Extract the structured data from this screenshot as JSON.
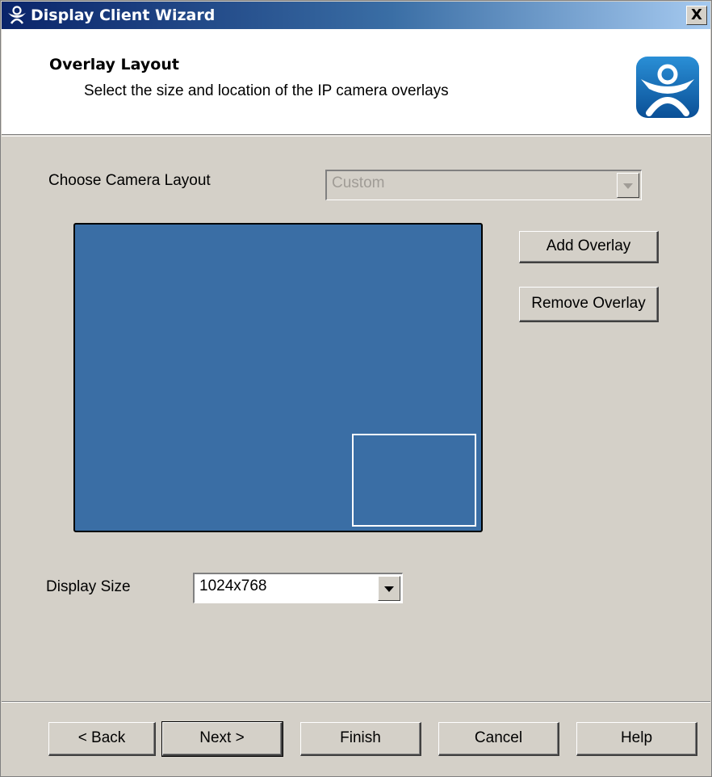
{
  "window": {
    "title": "Display Client Wizard",
    "close_label": "X",
    "icon": "thinmanager-icon"
  },
  "header": {
    "title": "Overlay Layout",
    "subtitle": "Select the size and location of the IP camera overlays",
    "logo": "thinmanager-logo"
  },
  "camera_layout": {
    "label": "Choose Camera Layout",
    "value": "Custom",
    "enabled": false
  },
  "preview": {
    "screen_color": "#3a6ea5",
    "overlay_border_color": "#ffffff"
  },
  "buttons": {
    "add_overlay": "Add Overlay",
    "remove_overlay": "Remove Overlay"
  },
  "display_size": {
    "label": "Display Size",
    "value": "1024x768"
  },
  "footer": {
    "back": "< Back",
    "next": "Next >",
    "finish": "Finish",
    "cancel": "Cancel",
    "help": "Help"
  },
  "colors": {
    "dialog_face": "#d4d0c8",
    "titlebar_start": "#0a246a",
    "titlebar_end": "#a6caf0"
  }
}
